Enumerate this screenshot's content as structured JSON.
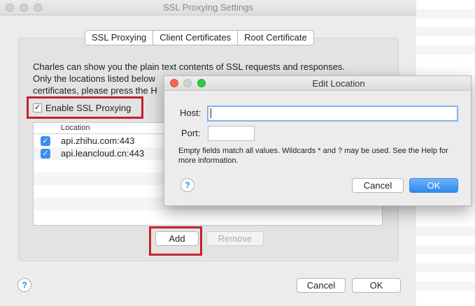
{
  "main_window": {
    "title": "SSL Proxying Settings",
    "tabs": [
      {
        "label": "SSL Proxying"
      },
      {
        "label": "Client Certificates"
      },
      {
        "label": "Root Certificate"
      }
    ],
    "description_lines": [
      "Charles can show you the plain text contents of SSL requests and responses.",
      "Only the locations listed below",
      "certificates, please press the H"
    ],
    "enable_checkbox": {
      "label": "Enable SSL Proxying",
      "checked": true
    },
    "table": {
      "column_header": "Location",
      "rows": [
        {
          "location": "api.zhihu.com:443",
          "checked": true
        },
        {
          "location": "api.leancloud.cn:443",
          "checked": true
        }
      ]
    },
    "add_label": "Add",
    "remove_label": "Remove",
    "help_label": "?",
    "cancel_label": "Cancel",
    "ok_label": "OK"
  },
  "dialog": {
    "title": "Edit Location",
    "host_label": "Host:",
    "host_value": "",
    "port_label": "Port:",
    "port_value": "",
    "note": "Empty fields match all values. Wildcards * and ? may be used. See the Help for more information.",
    "help_label": "?",
    "cancel_label": "Cancel",
    "ok_label": "OK"
  },
  "colors": {
    "highlight_red": "#c4212e",
    "accent_blue": "#3b8ef0",
    "traffic_red": "#fc605b",
    "traffic_yellow": "#fdbc40",
    "traffic_green": "#34c84a"
  }
}
